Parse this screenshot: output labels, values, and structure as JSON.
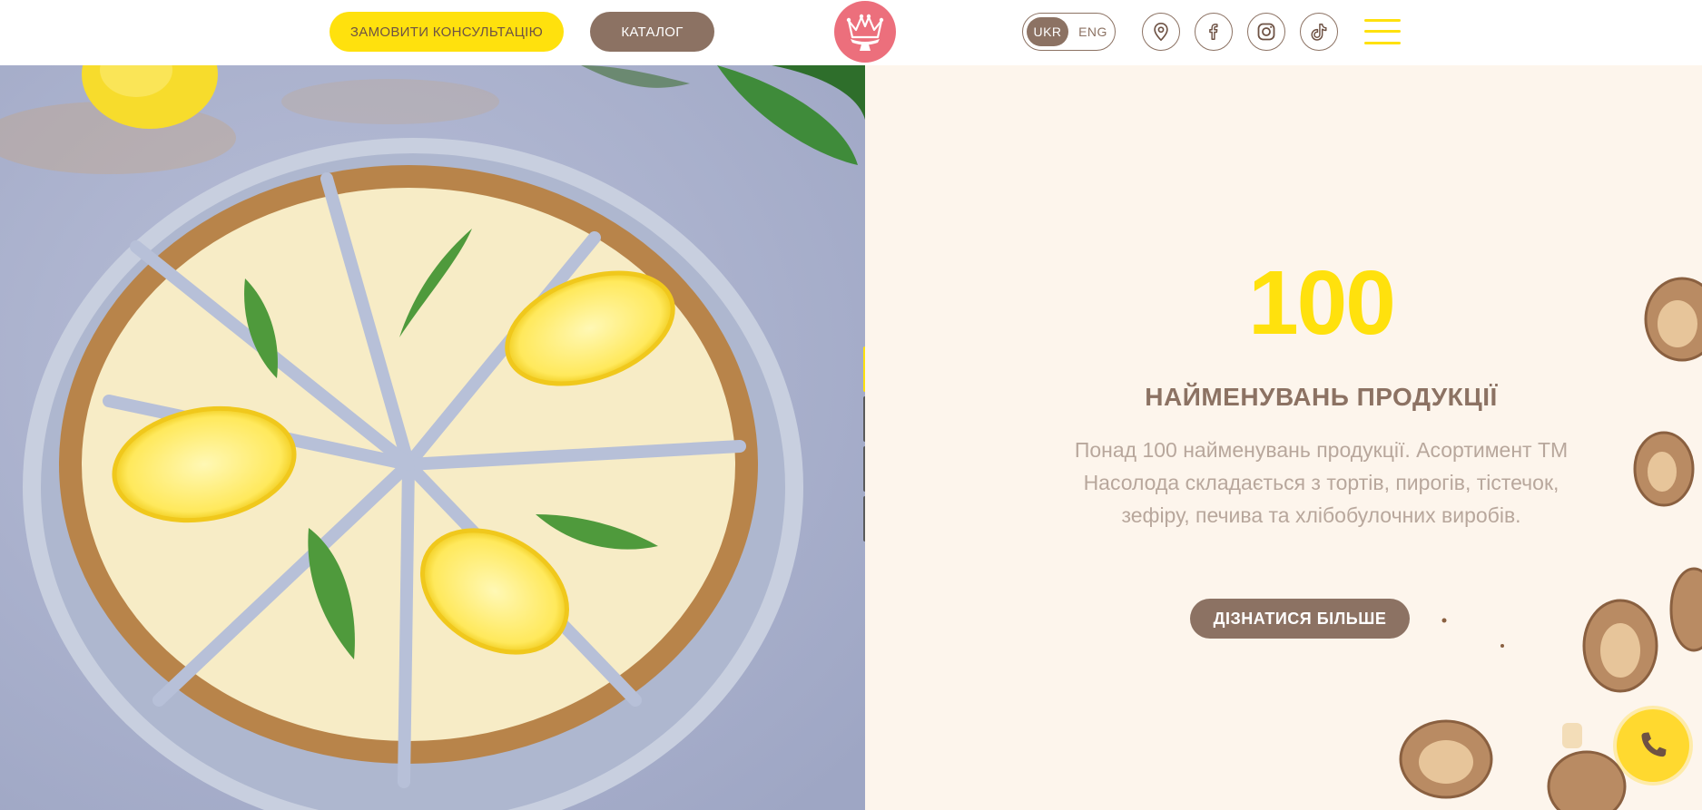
{
  "header": {
    "consult_button": "ЗАМОВИТИ КОНСУЛЬТАЦІЮ",
    "catalog_button": "КАТАЛОГ",
    "languages": [
      {
        "code": "UKR",
        "active": true
      },
      {
        "code": "ENG",
        "active": false
      }
    ],
    "social_icons": [
      "location-pin-icon",
      "facebook-icon",
      "instagram-icon",
      "tiktok-icon"
    ],
    "menu_icon": "hamburger-menu-icon"
  },
  "slider": {
    "slide_count": 4,
    "active_index": 0
  },
  "hero": {
    "number": "100",
    "subtitle": "НАЙМЕНУВАНЬ ПРОДУКЦІЇ",
    "description": "Понад 100 найменувань продукції. Асортимент ТМ Насолода складається з тортів, пирогів, тістечок, зефіру, печива та хлібобулочних виробів.",
    "more_button": "ДІЗНАТИСЯ БІЛЬШЕ"
  },
  "colors": {
    "accent_yellow": "#ffe10d",
    "brand_brown": "#8c7263",
    "logo_pink": "#ec6f7c",
    "panel_cream": "#fdf5ec"
  }
}
